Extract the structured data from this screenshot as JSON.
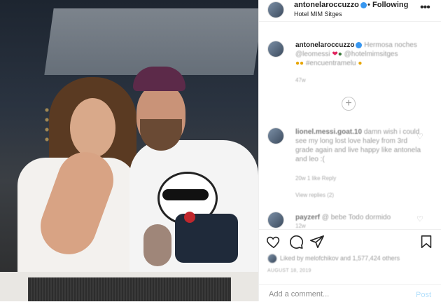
{
  "header": {
    "username": "antonelaroccuzzo",
    "separator": "•",
    "follow_label": "Following",
    "location": "Hotel MIM Sitges",
    "more_icon": "more-horizontal-icon"
  },
  "caption": {
    "username": "antonelaroccuzzo",
    "text_line1": "Hermosa noches",
    "mention1": "@leomessi",
    "mention2": "@hotelmimsitges",
    "hashtag": "#encuentramelu",
    "time": "47w"
  },
  "comments": [
    {
      "user": "lionel.messi.goat.10",
      "text": "damn wish i could see my long lost love haley from 3rd grade again and live happy like antonela and leo :(",
      "meta": "20w   1 like   Reply",
      "replies": "View replies (2)"
    },
    {
      "user": "payzerf",
      "text": "@ bebe Todo dormido",
      "meta": "12w"
    }
  ],
  "likes": {
    "text": "Liked by melofchikov and 1,577,424 others"
  },
  "date": "AUGUST 18, 2019",
  "add_comment": {
    "placeholder": "Add a comment...",
    "post_label": "Post"
  },
  "colors": {
    "verified": "#3897f0",
    "post_disabled": "#b2dffc",
    "heart": "#e0245e"
  }
}
